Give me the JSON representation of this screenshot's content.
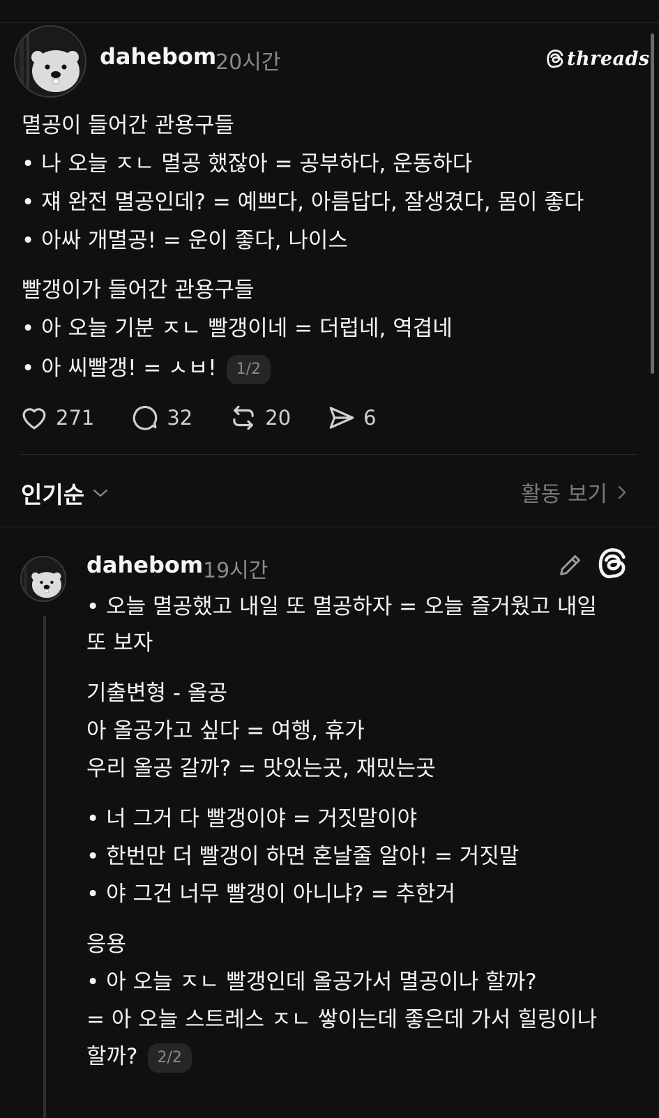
{
  "post": {
    "username": "dahebom",
    "time": "20시간",
    "brand": "threads",
    "lines": [
      "멸공이 들어간 관용구들",
      "• 나 오늘 ㅈㄴ 멸공 했잖아 = 공부하다, 운동하다",
      "• 쟤 완전 멸공인데? = 예쁘다, 아름답다, 잘생겼다, 몸이 좋다",
      "• 아싸 개멸공! = 운이 좋다, 나이스",
      "빨갱이가 들어간 관용구들",
      "• 아 오늘 기분 ㅈㄴ 빨갱이네 = 더럽네, 역겹네",
      "• 아 씨빨갱! = ㅅㅂ!"
    ],
    "pager": "1/2",
    "likes": "271",
    "comments": "32",
    "reposts": "20",
    "shares": "6"
  },
  "sort": {
    "label": "인기순",
    "activity": "활동 보기"
  },
  "reply": {
    "username": "dahebom",
    "time": "19시간",
    "lines": [
      "• 오늘 멸공했고 내일 또 멸공하자 = 오늘 즐거웠고 내일",
      "또 보자",
      "기출변형 - 올공",
      "아 올공가고 싶다 = 여행, 휴가",
      "우리 올공 갈까? = 맛있는곳, 재밌는곳",
      "• 너 그거 다 빨갱이야 = 거짓말이야",
      "• 한번만 더 빨갱이 하면 혼날줄 알아! = 거짓말",
      "• 야 그건 너무 빨갱이 아니냐? = 추한거",
      "응용",
      "• 아 오늘 ㅈㄴ 빨갱인데 올공가서 멸공이나 할까?",
      "= 아 오늘 스트레스 ㅈㄴ 쌓이는데 좋은데 가서 힐링이나",
      "할까?"
    ],
    "pager": "2/2"
  }
}
